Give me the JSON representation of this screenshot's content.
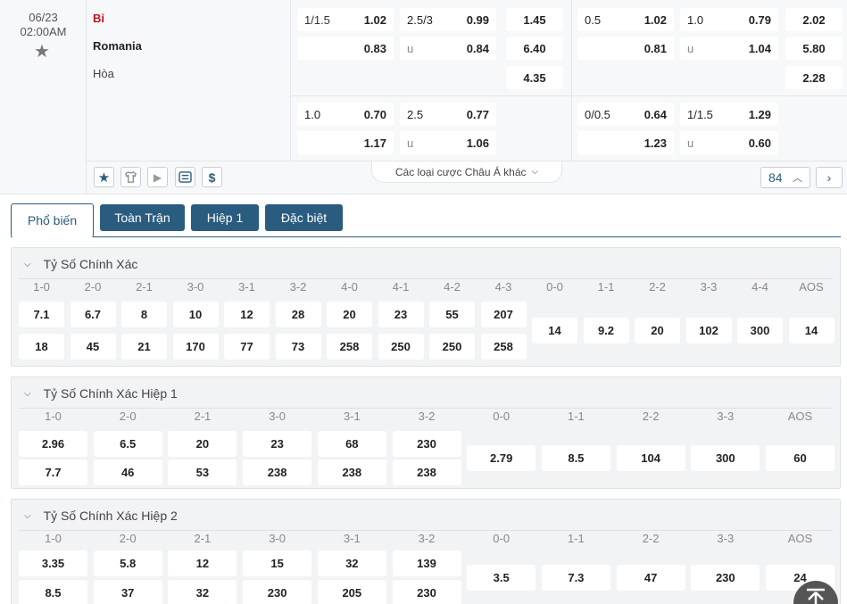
{
  "match": {
    "date": "06/23",
    "time": "02:00AM",
    "team_home": "Bỉ",
    "team_away": "Romania",
    "draw": "Hòa"
  },
  "odds": {
    "ft": {
      "hdp_line": "1/1.5",
      "hdp_home": "1.02",
      "hdp_away": "0.83",
      "ou_line": "2.5/3",
      "ou_over": "0.99",
      "ou_u": "u",
      "ou_under": "0.84",
      "x12_home": "1.45",
      "x12_away": "6.40",
      "x12_draw": "4.35",
      "hdp2_line": "1.0",
      "hdp2_home": "0.70",
      "hdp2_away": "1.17",
      "ou2_line": "2.5",
      "ou2_over": "0.77",
      "ou2_u": "u",
      "ou2_under": "1.06"
    },
    "h1": {
      "hdp_line": "0.5",
      "hdp_home": "1.02",
      "hdp_away": "0.81",
      "ou_line": "1.0",
      "ou_over": "0.79",
      "ou_u": "u",
      "ou_under": "1.04",
      "x12_home": "2.02",
      "x12_away": "5.80",
      "x12_draw": "2.28",
      "hdp2_line": "0/0.5",
      "hdp2_home": "0.64",
      "hdp2_away": "1.23",
      "ou2_line": "1/1.5",
      "ou2_over": "1.29",
      "ou2_u": "u",
      "ou2_under": "0.60"
    }
  },
  "toolbar": {
    "more_label": "Các loại cược Châu Á khác",
    "count": "84",
    "icons": [
      "star-icon",
      "jersey-icon",
      "play-icon",
      "ticket-icon",
      "dollar-icon"
    ]
  },
  "tabs": [
    "Phổ biến",
    "Toàn Trận",
    "Hiệp 1",
    "Đặc biệt"
  ],
  "colors": {
    "accent": "#2a5c80",
    "team_home": "#c0141b"
  },
  "sections": [
    {
      "title": "Tỷ Số Chính Xác",
      "home_headers": [
        "1-0",
        "2-0",
        "2-1",
        "3-0",
        "3-1",
        "3-2",
        "4-0",
        "4-1",
        "4-2",
        "4-3"
      ],
      "home_row1": [
        "7.1",
        "6.7",
        "8",
        "10",
        "12",
        "28",
        "20",
        "23",
        "55",
        "207"
      ],
      "home_row2": [
        "18",
        "45",
        "21",
        "170",
        "77",
        "73",
        "258",
        "250",
        "250",
        "258"
      ],
      "draw_headers": [
        "0-0",
        "1-1",
        "2-2",
        "3-3",
        "4-4",
        "AOS"
      ],
      "draw_values": [
        "14",
        "9.2",
        "20",
        "102",
        "300",
        "14"
      ]
    },
    {
      "title": "Tỷ Số Chính Xác Hiệp 1",
      "home_headers": [
        "1-0",
        "2-0",
        "2-1",
        "3-0",
        "3-1",
        "3-2"
      ],
      "home_row1": [
        "2.96",
        "6.5",
        "20",
        "23",
        "68",
        "230"
      ],
      "home_row2": [
        "7.7",
        "46",
        "53",
        "238",
        "238",
        "238"
      ],
      "draw_headers": [
        "0-0",
        "1-1",
        "2-2",
        "3-3",
        "AOS"
      ],
      "draw_values": [
        "2.79",
        "8.5",
        "104",
        "300",
        "60"
      ]
    },
    {
      "title": "Tỷ Số Chính Xác Hiệp 2",
      "home_headers": [
        "1-0",
        "2-0",
        "2-1",
        "3-0",
        "3-1",
        "3-2"
      ],
      "home_row1": [
        "3.35",
        "5.8",
        "12",
        "15",
        "32",
        "139"
      ],
      "home_row2": [
        "8.5",
        "37",
        "32",
        "230",
        "205",
        "230"
      ],
      "draw_headers": [
        "0-0",
        "1-1",
        "2-2",
        "3-3",
        "AOS"
      ],
      "draw_values": [
        "3.5",
        "7.3",
        "47",
        "230",
        "24"
      ]
    }
  ]
}
